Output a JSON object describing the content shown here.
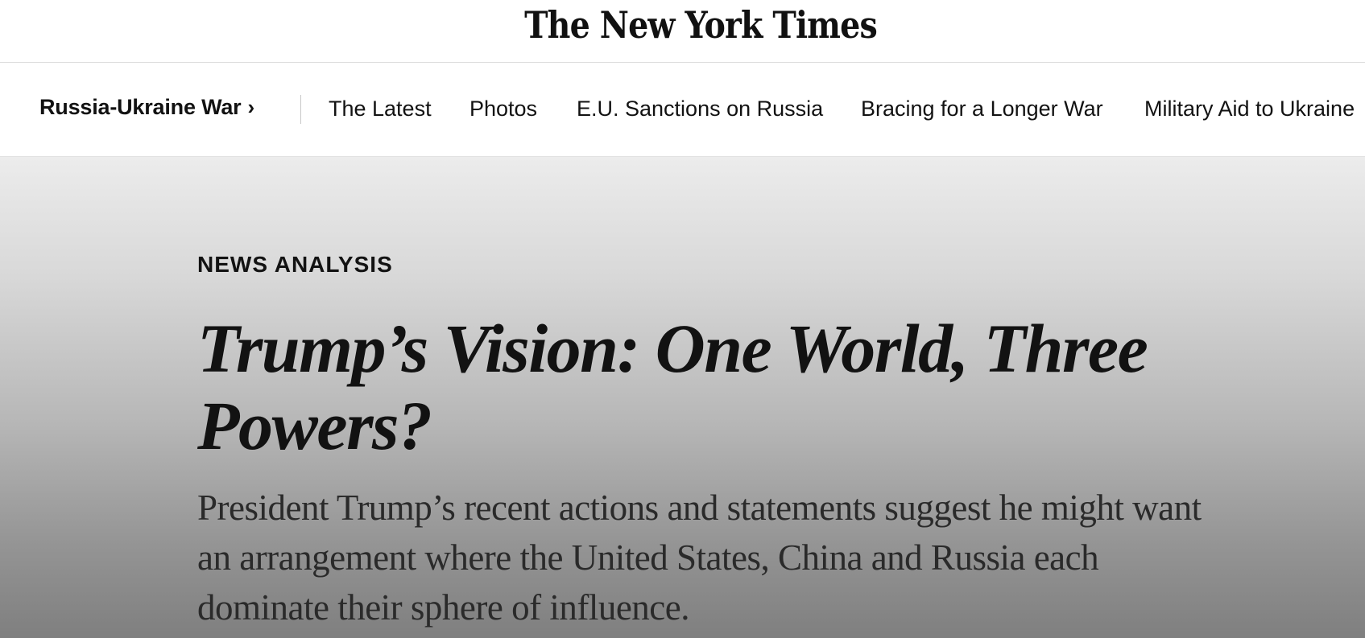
{
  "masthead": {
    "logo_text": "The New York Times"
  },
  "subnav": {
    "section_label": "Russia-Ukraine War",
    "section_chevron": "›",
    "items": [
      {
        "label": "The Latest"
      },
      {
        "label": "Photos"
      },
      {
        "label": "E.U. Sanctions on Russia"
      },
      {
        "label": "Bracing for a Longer War"
      },
      {
        "label": "Military Aid to Ukraine"
      }
    ]
  },
  "article": {
    "kicker": "NEWS ANALYSIS",
    "headline": "Trump’s Vision: One World, Three Powers?",
    "summary": "President Trump’s recent actions and statements suggest he might want an arrangement where the United States, China and Russia each dominate their sphere of influence."
  },
  "colors": {
    "text": "#121212",
    "hero_gradient_top": "#ececec",
    "hero_gradient_bottom": "#7f7f7f"
  }
}
